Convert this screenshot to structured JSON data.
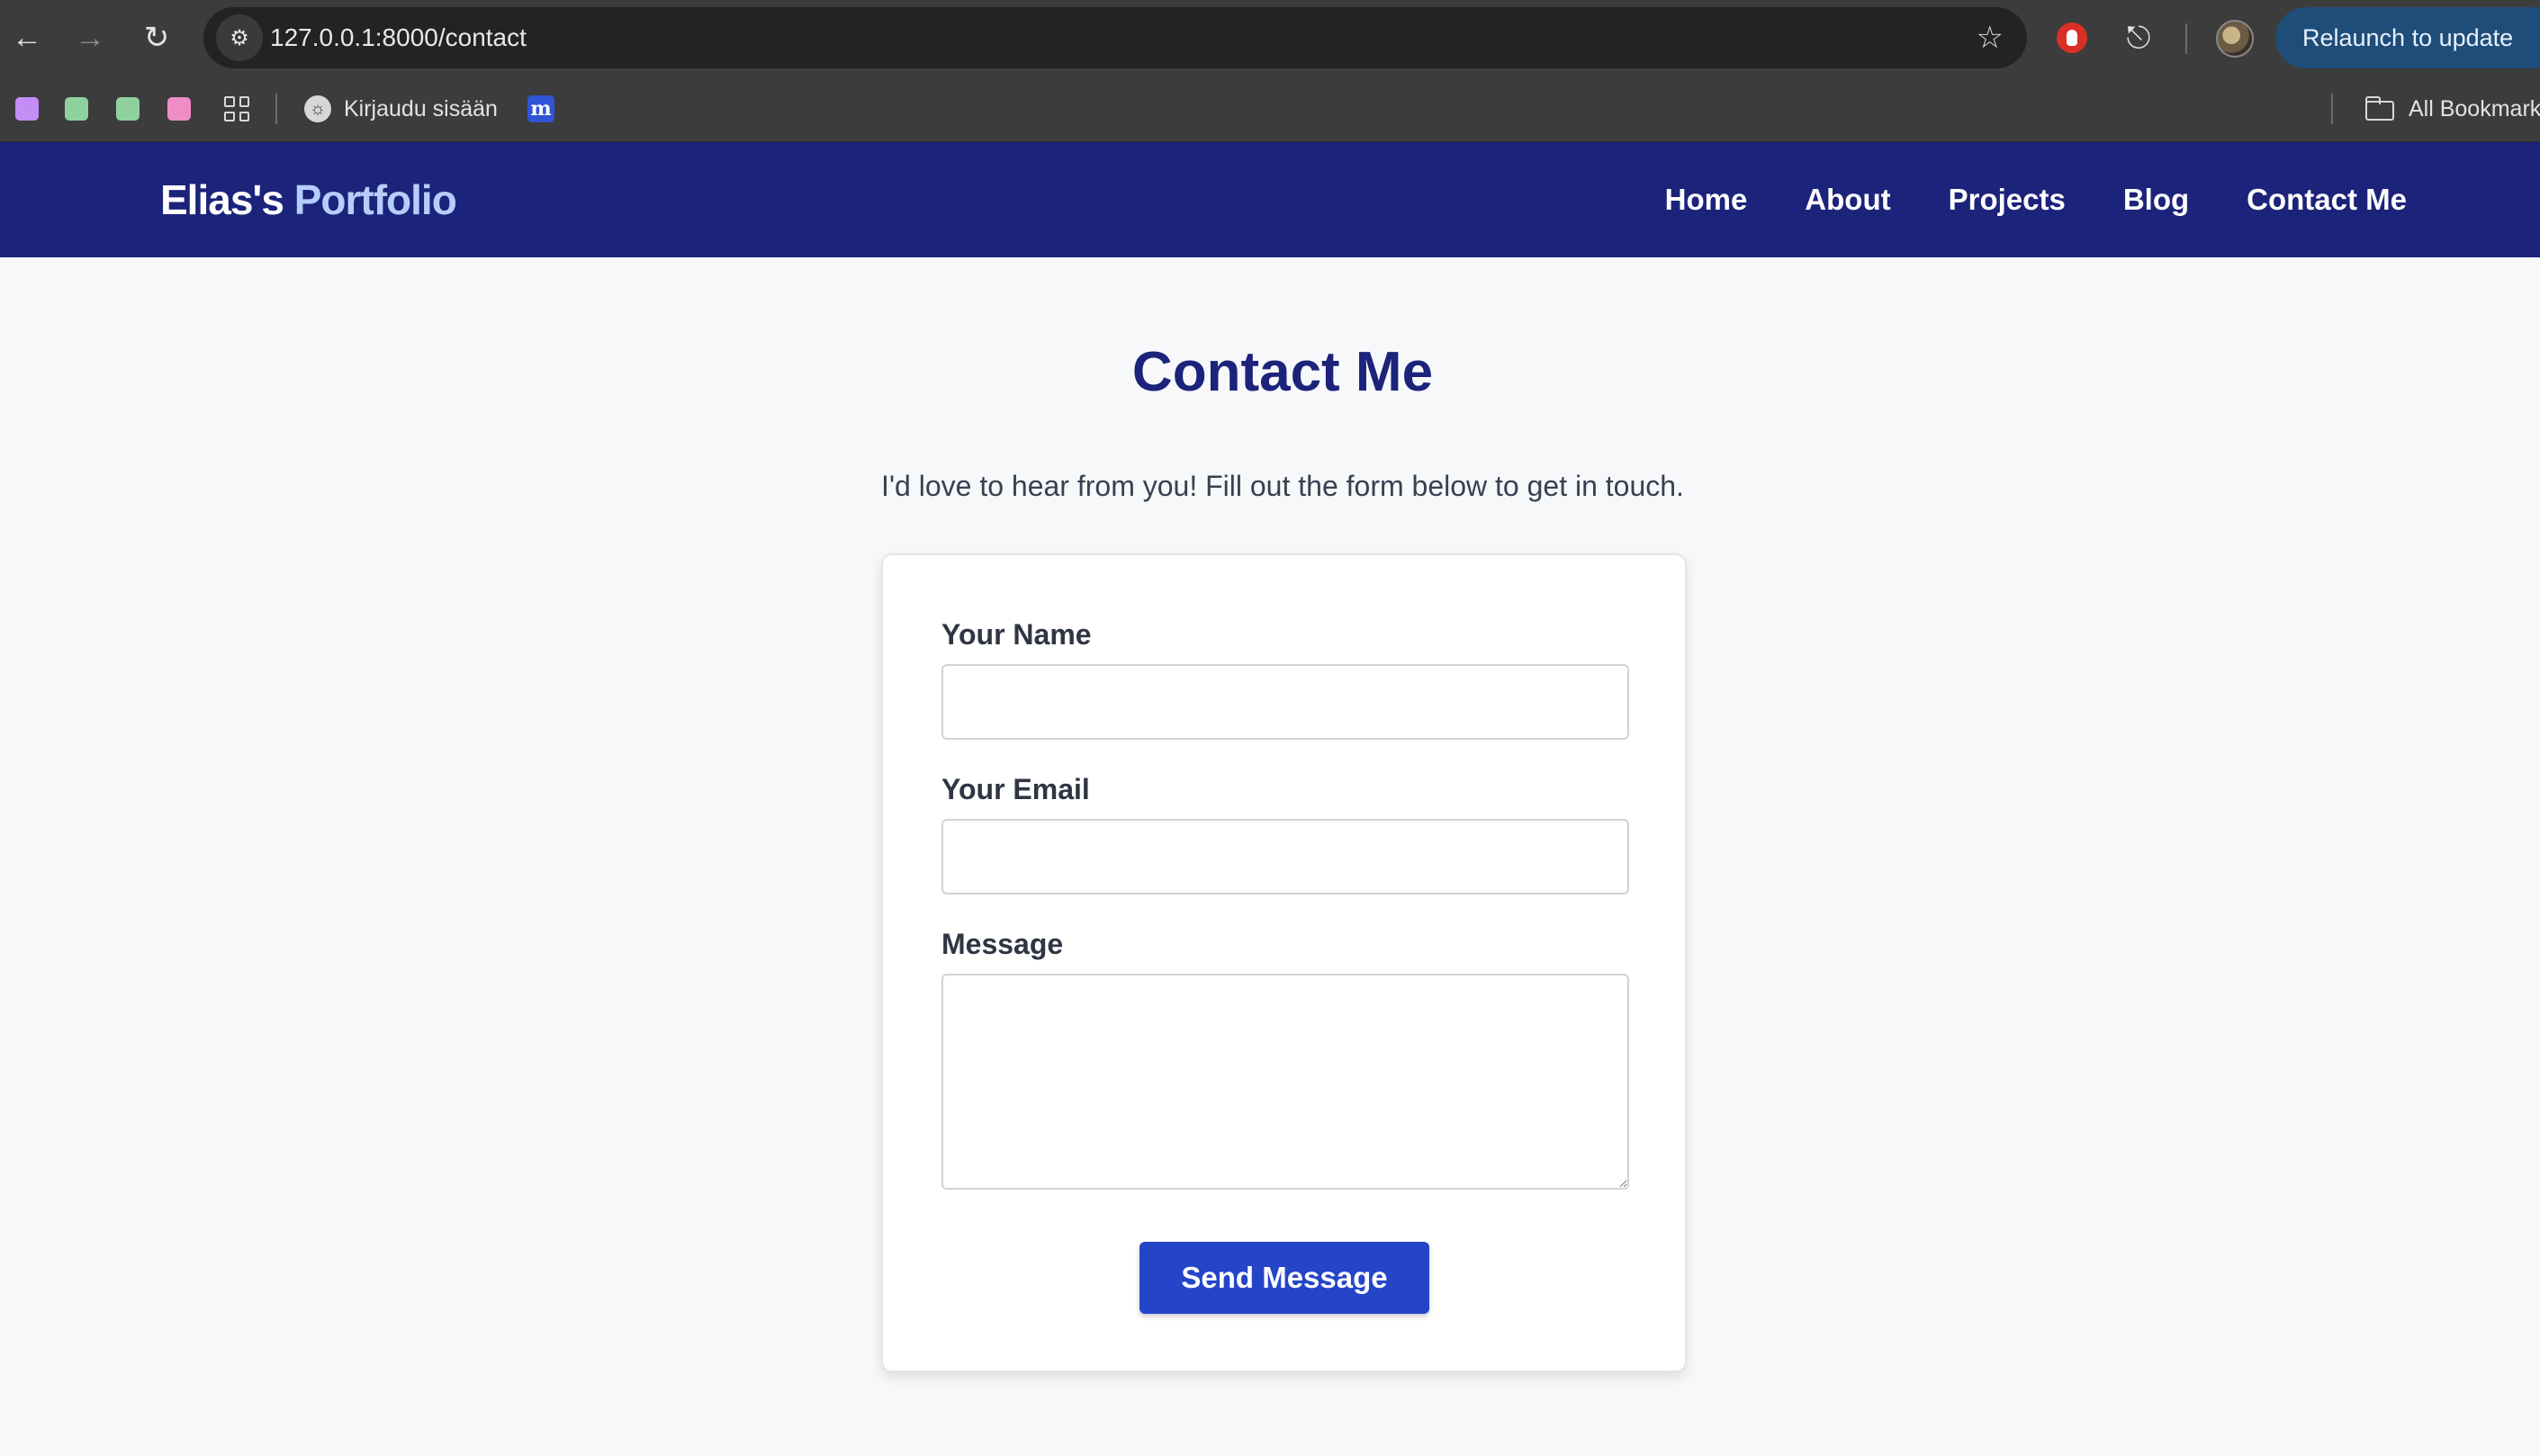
{
  "browser": {
    "url": "127.0.0.1:8000/contact",
    "relaunch_label": "Relaunch to update",
    "icons": {
      "back": "back-arrow-icon",
      "forward": "forward-arrow-icon",
      "reload": "reload-icon",
      "site_info": "site-settings-icon",
      "bookmark_star": "star-icon",
      "extension_red": "stop-hand-icon",
      "extensions": "puzzle-icon",
      "menu": "vertical-dots-icon"
    },
    "bookmarks": {
      "swatches": [
        "#c48cf5",
        "#8fd19e",
        "#8fd19e",
        "#f08dc6"
      ],
      "item_label": "Kirjaudu sisään",
      "all_bookmarks_label": "All Bookmarks"
    }
  },
  "site": {
    "brand_first": "Elias's",
    "brand_accent": "Portfolio",
    "brand_colors": {
      "header_bg": "#1c237a",
      "accent": "#b6cdfb",
      "button": "#2545c8"
    },
    "nav": [
      {
        "label": "Home"
      },
      {
        "label": "About"
      },
      {
        "label": "Projects"
      },
      {
        "label": "Blog"
      },
      {
        "label": "Contact Me"
      }
    ]
  },
  "main": {
    "title": "Contact Me",
    "intro": "I'd love to hear from you! Fill out the form below to get in touch.",
    "form": {
      "name_label": "Your Name",
      "name_value": "",
      "email_label": "Your Email",
      "email_value": "",
      "message_label": "Message",
      "message_value": "",
      "submit_label": "Send Message"
    }
  }
}
